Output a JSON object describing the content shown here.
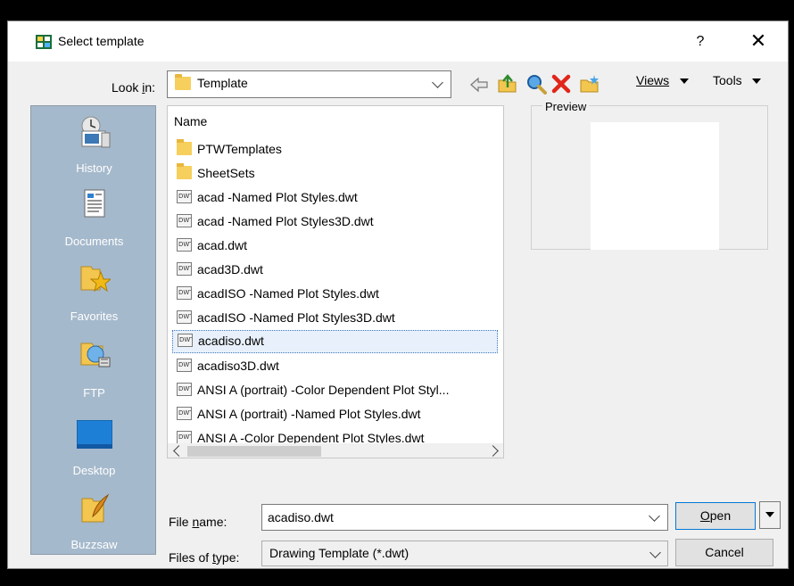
{
  "window": {
    "title": "Select template",
    "help": "?",
    "close": "✕"
  },
  "look_in": {
    "label_prefix": "Look ",
    "label_key": "i",
    "label_suffix": "n:",
    "value": "Template"
  },
  "toolbar": {
    "views": "Views",
    "tools": "Tools",
    "icons": [
      "back-arrow-icon",
      "up-folder-icon",
      "search-web-icon",
      "delete-icon",
      "new-folder-icon"
    ]
  },
  "places": [
    {
      "label": "History",
      "icon": "history-icon"
    },
    {
      "label": "Documents",
      "icon": "documents-icon"
    },
    {
      "label": "Favorites",
      "icon": "favorites-icon"
    },
    {
      "label": "FTP",
      "icon": "ftp-icon"
    },
    {
      "label": "Desktop",
      "icon": "desktop-icon"
    },
    {
      "label": "Buzzsaw",
      "icon": "buzzsaw-icon"
    }
  ],
  "file_list": {
    "column_header": "Name",
    "items": [
      {
        "name": "PTWTemplates",
        "type": "folder"
      },
      {
        "name": "SheetSets",
        "type": "folder"
      },
      {
        "name": "acad -Named Plot Styles.dwt",
        "type": "dwt"
      },
      {
        "name": "acad -Named Plot Styles3D.dwt",
        "type": "dwt"
      },
      {
        "name": "acad.dwt",
        "type": "dwt"
      },
      {
        "name": "acad3D.dwt",
        "type": "dwt"
      },
      {
        "name": "acadISO -Named Plot Styles.dwt",
        "type": "dwt"
      },
      {
        "name": "acadISO -Named Plot Styles3D.dwt",
        "type": "dwt"
      },
      {
        "name": "acadiso.dwt",
        "type": "dwt",
        "selected": true
      },
      {
        "name": "acadiso3D.dwt",
        "type": "dwt"
      },
      {
        "name": "ANSI A (portrait) -Color Dependent Plot Styl...",
        "type": "dwt"
      },
      {
        "name": "ANSI A (portrait) -Named Plot Styles.dwt",
        "type": "dwt"
      },
      {
        "name": "ANSI A -Color Dependent Plot Styles.dwt",
        "type": "dwt"
      }
    ]
  },
  "preview": {
    "label": "Preview"
  },
  "file_name": {
    "label_prefix": "File ",
    "label_key": "n",
    "label_suffix": "ame:",
    "value": "acadiso.dwt"
  },
  "files_of_type": {
    "label_prefix": "Files of ",
    "label_key": "t",
    "label_suffix": "ype:",
    "value": "Drawing Template (*.dwt)"
  },
  "buttons": {
    "open_key": "O",
    "open_rest": "pen",
    "cancel": "Cancel"
  },
  "colors": {
    "places_bg": "#a5b9cc",
    "selection_border": "#3d78c0",
    "delete_red": "#e0261b"
  }
}
